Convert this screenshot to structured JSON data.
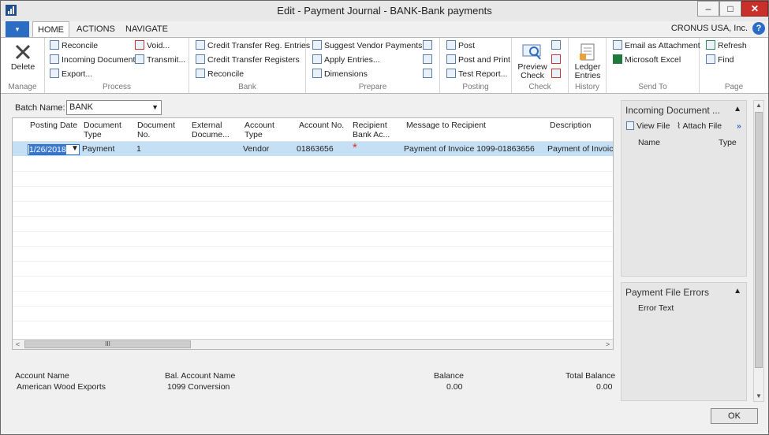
{
  "window": {
    "title": "Edit - Payment Journal - BANK-Bank payments"
  },
  "tabs": {
    "home": "HOME",
    "actions": "ACTIONS",
    "navigate": "NAVIGATE",
    "file": "▾"
  },
  "company": "CRONUS USA, Inc.",
  "ribbon": {
    "manage": {
      "label": "Manage",
      "delete": "Delete"
    },
    "process": {
      "label": "Process",
      "reconcile": "Reconcile",
      "incoming": "Incoming Document",
      "export": "Export...",
      "void": "Void...",
      "transmit": "Transmit..."
    },
    "bank": {
      "label": "Bank",
      "ctre": "Credit Transfer Reg. Entries",
      "ctr": "Credit Transfer Registers",
      "reconcile": "Reconcile"
    },
    "prepare": {
      "label": "Prepare",
      "suggest": "Suggest Vendor Payments...",
      "apply": "Apply Entries...",
      "dimensions": "Dimensions"
    },
    "posting": {
      "label": "Posting",
      "post": "Post",
      "post_print": "Post and Print",
      "test_report": "Test Report..."
    },
    "check": {
      "label": "Check",
      "preview_line1": "Preview",
      "preview_line2": "Check"
    },
    "history": {
      "label": "History",
      "ledger_line1": "Ledger",
      "ledger_line2": "Entries"
    },
    "sendto": {
      "label": "Send To",
      "email": "Email as Attachment",
      "excel": "Microsoft Excel"
    },
    "page": {
      "label": "Page",
      "refresh": "Refresh",
      "find": "Find"
    }
  },
  "batch": {
    "label": "Batch Name:",
    "value": "BANK"
  },
  "grid": {
    "headers": {
      "posting_date": "Posting Date",
      "doc_type_1": "Document",
      "doc_type_2": "Type",
      "doc_no_1": "Document",
      "doc_no_2": "No.",
      "ext_doc_1": "External",
      "ext_doc_2": "Docume...",
      "acc_type_1": "Account",
      "acc_type_2": "Type",
      "acc_no": "Account No.",
      "recip_1": "Recipient",
      "recip_2": "Bank Ac...",
      "message": "Message to Recipient",
      "description": "Description"
    },
    "row": {
      "posting_date": "1/26/2018",
      "doc_type": "Payment",
      "doc_no": "1",
      "acc_type": "Vendor",
      "acc_no": "01863656",
      "recip_mark": "*",
      "message": "Payment of Invoice 1099-01863656",
      "description": "Payment of Invoice"
    },
    "hscroll_thumb": "III"
  },
  "footer": {
    "account_name_label": "Account Name",
    "account_name": "American Wood Exports",
    "bal_account_label": "Bal. Account Name",
    "bal_account": "1099 Conversion",
    "balance_label": "Balance",
    "balance": "0.00",
    "total_balance_label": "Total Balance",
    "total_balance": "0.00"
  },
  "factbox_incoming": {
    "title": "Incoming Document ...",
    "view_file": "View File",
    "attach_file": "Attach File",
    "more": "»",
    "col_name": "Name",
    "col_type": "Type"
  },
  "factbox_errors": {
    "title": "Payment File Errors",
    "col_error": "Error Text"
  },
  "ok": "OK"
}
